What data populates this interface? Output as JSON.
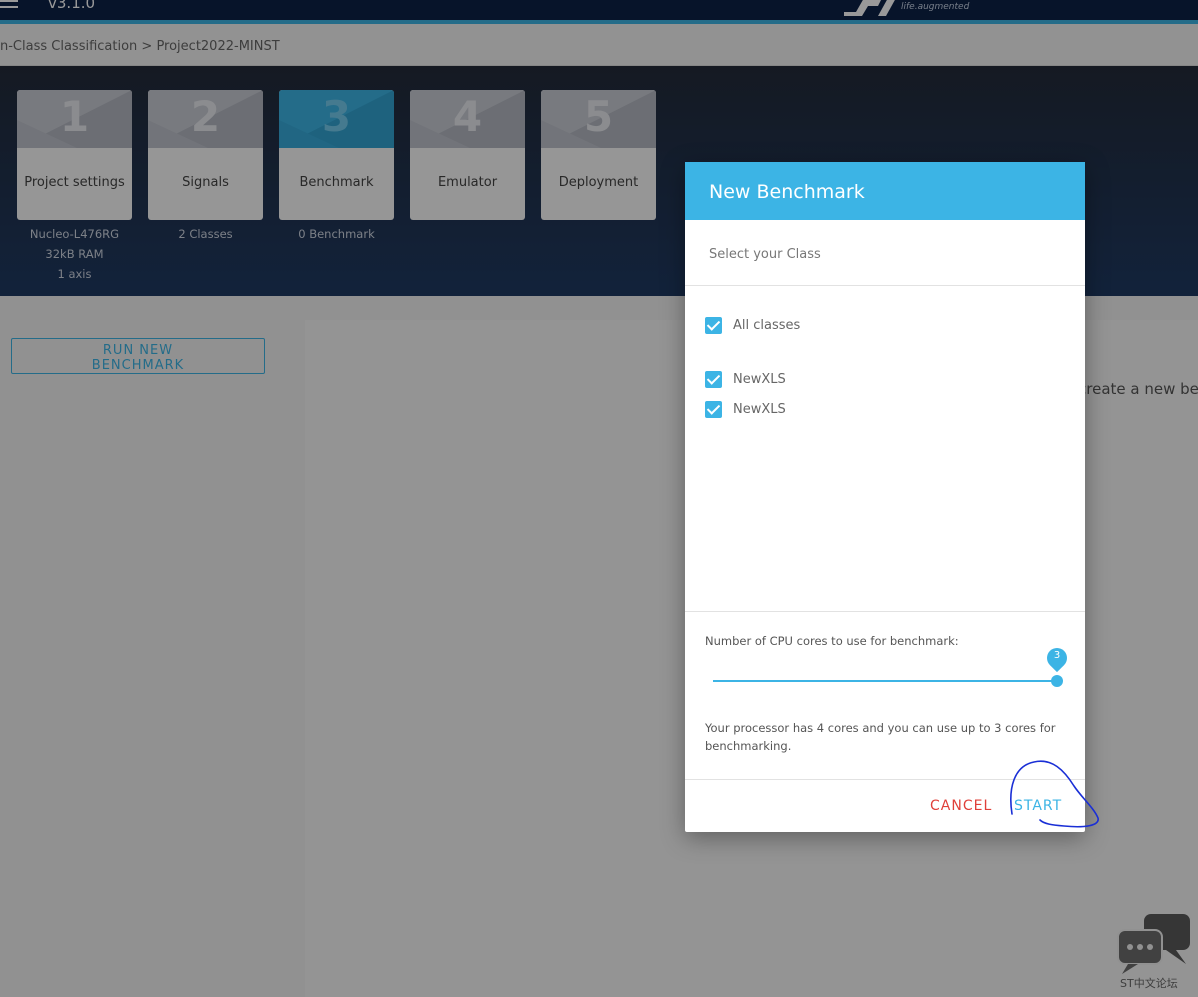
{
  "header": {
    "version": "v3.1.0",
    "tagline": "life.augmented"
  },
  "breadcrumb": "n-Class Classification > Project2022-MINST",
  "steps": [
    {
      "number": "1",
      "label": "Project settings",
      "sub": [
        "Nucleo-L476RG",
        "32kB RAM",
        "1 axis"
      ]
    },
    {
      "number": "2",
      "label": "Signals",
      "sub": [
        "2 Classes"
      ]
    },
    {
      "number": "3",
      "label": "Benchmark",
      "sub": [
        "0 Benchmark"
      ]
    },
    {
      "number": "4",
      "label": "Emulator",
      "sub": []
    },
    {
      "number": "5",
      "label": "Deployment",
      "sub": []
    }
  ],
  "content": {
    "run_button_line1": "RUN NEW",
    "run_button_line2": "BENCHMARK",
    "hint": "create a new ben"
  },
  "modal": {
    "title": "New Benchmark",
    "subtitle": "Select your Class",
    "all_classes_label": "All classes",
    "classes": [
      "NewXLS",
      "NewXLS"
    ],
    "cores_label": "Number of CPU cores to use for benchmark:",
    "cores_value": "3",
    "processor_text": "Your processor has 4 cores and you can use up to 3 cores for benchmarking.",
    "cancel_label": "CANCEL",
    "start_label": "START"
  },
  "chat_widget": {
    "caption": "ST中文论坛"
  },
  "colors": {
    "accent": "#3cb4e5",
    "navy": "#0d2247",
    "cancel": "#e0403a"
  }
}
